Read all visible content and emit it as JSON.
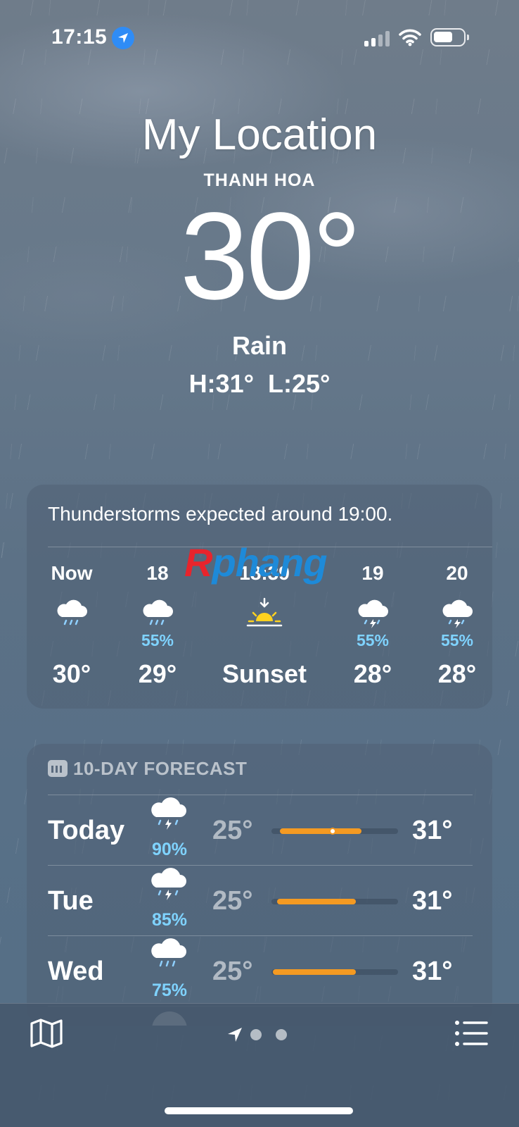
{
  "status_bar": {
    "time": "17:15",
    "icons": [
      "location-services-icon",
      "cellular-signal-icon",
      "wifi-icon",
      "battery-icon"
    ]
  },
  "header": {
    "location_title": "My Location",
    "city": "THANH HOA",
    "temperature": "30°",
    "condition": "Rain",
    "high_low": "H:31° L:25°"
  },
  "hourly": {
    "summary": "Thunderstorms expected around 19:00.",
    "items": [
      {
        "label": "Now",
        "icon": "rain-cloud-icon",
        "precip": "",
        "temp": "30°"
      },
      {
        "label": "18",
        "icon": "rain-cloud-icon",
        "precip": "55%",
        "temp": "29°"
      },
      {
        "label": "18:39",
        "icon": "sunset-icon",
        "precip": "",
        "temp": "Sunset"
      },
      {
        "label": "19",
        "icon": "thunderstorm-icon",
        "precip": "55%",
        "temp": "28°"
      },
      {
        "label": "20",
        "icon": "thunderstorm-icon",
        "precip": "55%",
        "temp": "28°"
      }
    ]
  },
  "watermark": {
    "first_letter": "R",
    "rest": "phang"
  },
  "daily": {
    "header": "10-DAY FORECAST",
    "days": [
      {
        "day": "Today",
        "icon": "thunderstorm-icon",
        "precip": "90%",
        "low": "25°",
        "high": "31°"
      },
      {
        "day": "Tue",
        "icon": "thunderstorm-icon",
        "precip": "85%",
        "low": "25°",
        "high": "31°"
      },
      {
        "day": "Wed",
        "icon": "rain-cloud-icon",
        "precip": "75%",
        "low": "25°",
        "high": "31°"
      }
    ]
  },
  "toolbar": {
    "icons": [
      "map-icon",
      "current-location-arrow-icon",
      "list-icon"
    ]
  },
  "colors": {
    "accent_precip": "#7fd3ff",
    "range_bar": "#f49a22",
    "sun": "#ffd21f",
    "location_badge": "#2f8cf6"
  }
}
